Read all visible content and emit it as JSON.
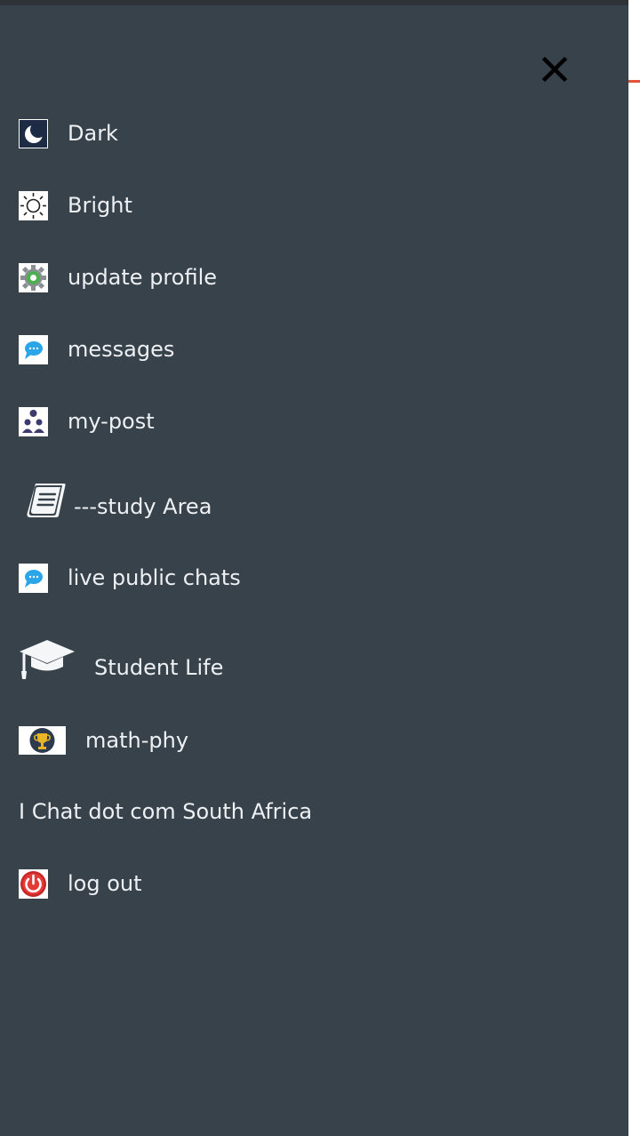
{
  "drawer": {
    "close_icon": "close-icon",
    "colors": {
      "drawer_bg": "#37424b",
      "text": "#eef1f3",
      "accent": "#e0533a"
    },
    "items": [
      {
        "label": "Dark",
        "icon": "moon-icon"
      },
      {
        "label": "Bright",
        "icon": "sun-icon"
      },
      {
        "label": "update profile",
        "icon": "settings-gear-icon"
      },
      {
        "label": "messages",
        "icon": "chat-bubble-icon"
      },
      {
        "label": "my-post",
        "icon": "people-icon"
      },
      {
        "label": "---study Area",
        "icon": "book-icon"
      },
      {
        "label": "live public chats",
        "icon": "chat-bubble-icon"
      },
      {
        "label": "Student Life",
        "icon": "graduation-cap-icon"
      },
      {
        "label": "math-phy",
        "icon": "trophy-icon"
      },
      {
        "label": "I Chat dot com South Africa",
        "icon": ""
      },
      {
        "label": "log out",
        "icon": "power-icon"
      }
    ]
  }
}
